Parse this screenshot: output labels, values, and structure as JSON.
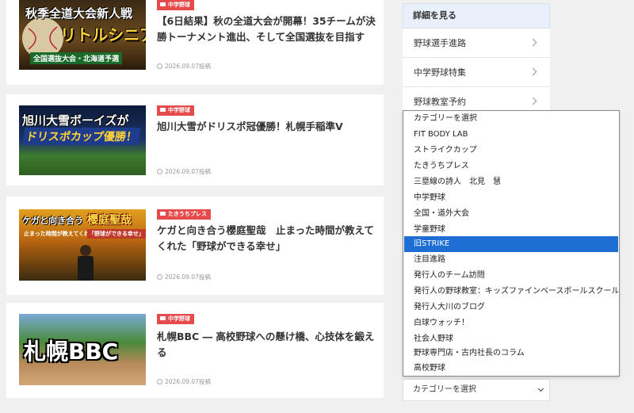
{
  "posts": [
    {
      "category": "中学野球",
      "title": "【6日結果】秋の全道大会が開幕！35チームが決勝トーナメント進出、そして全国選抜を目指す",
      "date": "2026.09.07投稿",
      "thumb_lines": [
        "秋季全道大会新人戦",
        "リトルシニア",
        "全国選抜大会・北海道予選"
      ]
    },
    {
      "category": "中学野球",
      "title": "旭川大雪がドリスポ冠優勝！札幌手稲準V",
      "date": "2026.09.07投稿",
      "thumb_lines": [
        "旭川大雪ボーイズが",
        "ドリスポカップ優勝！"
      ]
    },
    {
      "category": "たきうちプレス",
      "title": "ケガと向き合う櫻庭聖哉　止まった時間が教えてくれた「野球ができる幸せ」",
      "date": "2026.09.07投稿",
      "thumb_lines": [
        "ケガと向き合う",
        "櫻庭聖哉",
        "止まった時間が教えてくれた",
        "「野球ができる幸せ」"
      ]
    },
    {
      "category": "中学野球",
      "title": "札幌BBC ― 高校野球への懸け橋、心技体を鍛える",
      "date": "2026.09.07投稿",
      "thumb_lines": [
        "札幌BBC"
      ]
    }
  ],
  "sidebar": {
    "header": "詳細を見る",
    "items": [
      "野球選手進路",
      "中学野球特集",
      "野球教室予約"
    ]
  },
  "category_dropdown": {
    "options": [
      "カテゴリーを選択",
      "FIT BODY LAB",
      "ストライクカップ",
      "たきうちプレス",
      "三塁線の詩人　北見　慧",
      "中学野球",
      "全国・道外大会",
      "学童野球",
      "旧STRIKE",
      "注目進路",
      "発行人のチーム訪問",
      "発行人の野球教室：キッズファインベースボールスクール",
      "発行人大川のブログ",
      "白球ウォッチ！",
      "社会人野球",
      "野球専門店・古内社長のコラム",
      "高校野球"
    ],
    "selected": "旧STRIKE",
    "select_value": "カテゴリーを選択"
  },
  "colors": {
    "category_badge": "#e54b4b",
    "selected_option": "#1f6ed4",
    "sidebar_header_bg": "#e8f0fb"
  }
}
